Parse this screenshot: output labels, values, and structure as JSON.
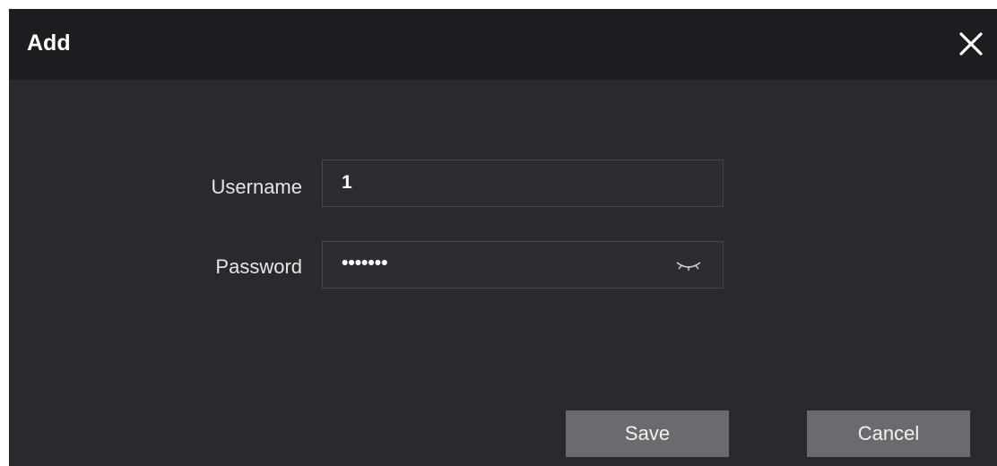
{
  "dialog": {
    "title": "Add",
    "close_icon": "close-icon"
  },
  "form": {
    "username": {
      "label": "Username",
      "value": "1"
    },
    "password": {
      "label": "Password",
      "masked_value": "•••••••",
      "toggle_icon": "eye-closed-icon"
    }
  },
  "footer": {
    "save_label": "Save",
    "cancel_label": "Cancel"
  },
  "colors": {
    "dialog_background": "#29292e",
    "titlebar_background": "#1d1d21",
    "input_background": "#2c2d33",
    "button_background": "#6a6a6f"
  }
}
